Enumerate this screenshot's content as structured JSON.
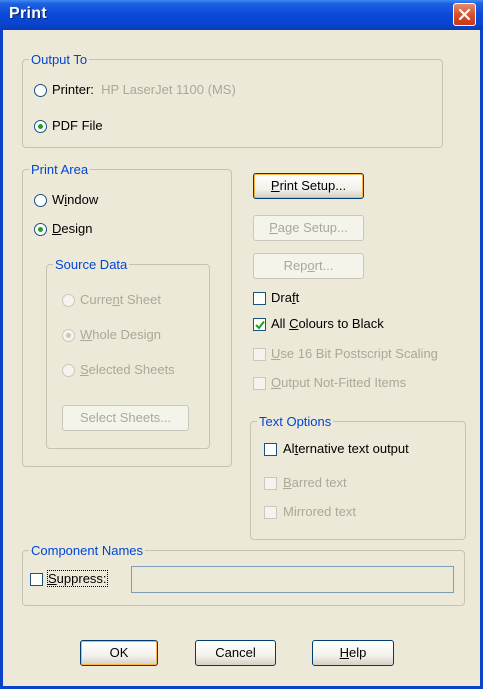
{
  "window": {
    "title": "Print",
    "close_icon": "close-icon"
  },
  "output_to": {
    "legend": "Output To",
    "printer_label": "Printer:",
    "printer_name": "HP LaserJet 1100 (MS)",
    "pdf_label": "PDF File",
    "selected": "pdf"
  },
  "print_area": {
    "legend": "Print Area",
    "window_pre": "W",
    "window_u": "i",
    "window_post": "ndow",
    "design_pre": "",
    "design_u": "D",
    "design_post": "esign",
    "selected": "design"
  },
  "source_data": {
    "legend": "Source Data",
    "current_pre": "Curre",
    "current_u": "n",
    "current_post": "t Sheet",
    "whole_pre": "",
    "whole_u": "W",
    "whole_post": "hole Design",
    "selected_pre": "",
    "selected_u": "S",
    "selected_post": "elected Sheets",
    "select_button": "Select Sheets..."
  },
  "buttons": {
    "print_setup_u": "P",
    "print_setup_post": "rint Setup...",
    "page_setup_u": "P",
    "page_setup_post": "age Setup...",
    "report_pre": "Rep",
    "report_u": "o",
    "report_post": "rt...",
    "ok": "OK",
    "cancel": "Cancel",
    "help_u": "H",
    "help_post": "elp"
  },
  "options": {
    "draft_pre": "Dra",
    "draft_u": "f",
    "draft_post": "t",
    "draft_checked": false,
    "black_pre": "All ",
    "black_u": "C",
    "black_post": "olours to Black",
    "black_checked": true,
    "postscript_pre": "",
    "postscript_u": "U",
    "postscript_post": "se 16 Bit Postscript Scaling",
    "notfitted_pre": "",
    "notfitted_u": "O",
    "notfitted_post": "utput Not-Fitted Items"
  },
  "text_options": {
    "legend": "Text Options",
    "alt_pre": "Al",
    "alt_u": "t",
    "alt_post": "ernative text output",
    "barred_pre": "",
    "barred_u": "B",
    "barred_post": "arred text",
    "mirrored_label": "Mirrored text"
  },
  "component_names": {
    "legend": "Component Names",
    "suppress_pre": "",
    "suppress_u": "S",
    "suppress_post": "uppress:",
    "name_value": ""
  },
  "colors": {
    "title_blue": "#0a48d8",
    "legend_blue": "#0046d5",
    "check_green": "#21a121"
  }
}
